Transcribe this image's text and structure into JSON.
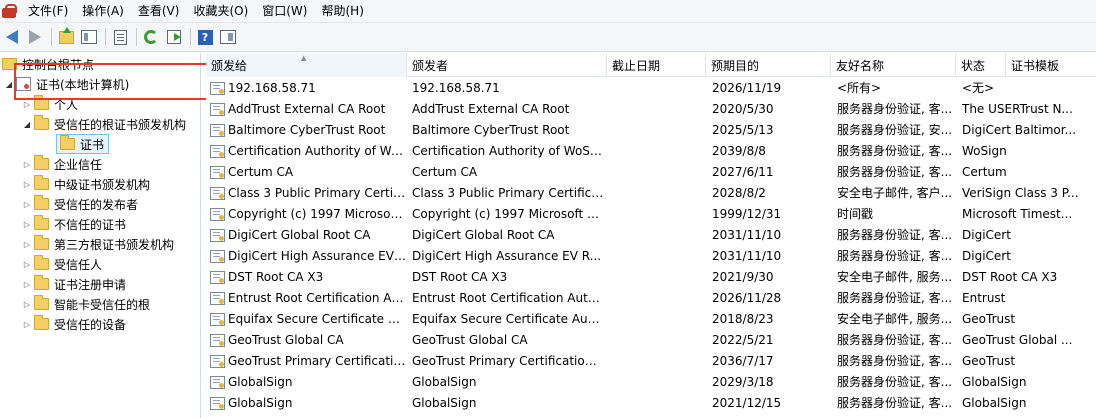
{
  "menubar": {
    "items": [
      "文件(F)",
      "操作(A)",
      "查看(V)",
      "收藏夹(O)",
      "窗口(W)",
      "帮助(H)"
    ]
  },
  "toolbar": {
    "icons": [
      "back-arrow-icon",
      "forward-arrow-icon",
      "up-folder-icon",
      "show-tree-icon",
      "properties-icon",
      "refresh-icon",
      "export-list-icon",
      "help-icon",
      "show-action-pane-icon"
    ]
  },
  "tree": {
    "root": "控制台根节点",
    "computer": "证书(本地计算机)",
    "personal": "个人",
    "trusted_root": "受信任的根证书颁发机构",
    "certs": "证书",
    "items": [
      "企业信任",
      "中级证书颁发机构",
      "受信任的发布者",
      "不信任的证书",
      "第三方根证书颁发机构",
      "受信任人",
      "证书注册申请",
      "智能卡受信任的根",
      "受信任的设备"
    ]
  },
  "list": {
    "columns": [
      "颁发给",
      "颁发者",
      "截止日期",
      "预期目的",
      "友好名称",
      "状态",
      "证书模板"
    ],
    "rows": [
      [
        "192.168.58.71",
        "192.168.58.71",
        "2026/11/19",
        "<所有>",
        "<无>"
      ],
      [
        "AddTrust External CA Root",
        "AddTrust External CA Root",
        "2020/5/30",
        "服务器身份验证, 客...",
        "The USERTrust N..."
      ],
      [
        "Baltimore CyberTrust Root",
        "Baltimore CyberTrust Root",
        "2025/5/13",
        "服务器身份验证, 安...",
        "DigiCert Baltimor..."
      ],
      [
        "Certification Authority of Wo...",
        "Certification Authority of WoSi...",
        "2039/8/8",
        "服务器身份验证, 客...",
        "WoSign"
      ],
      [
        "Certum CA",
        "Certum CA",
        "2027/6/11",
        "服务器身份验证, 客...",
        "Certum"
      ],
      [
        "Class 3 Public Primary Certifi...",
        "Class 3 Public Primary Certifica...",
        "2028/8/2",
        "安全电子邮件, 客户...",
        "VeriSign Class 3 P..."
      ],
      [
        "Copyright (c) 1997 Microsoft...",
        "Copyright (c) 1997 Microsoft C...",
        "1999/12/31",
        "时间戳",
        "Microsoft Timest..."
      ],
      [
        "DigiCert Global Root CA",
        "DigiCert Global Root CA",
        "2031/11/10",
        "服务器身份验证, 客...",
        "DigiCert"
      ],
      [
        "DigiCert High Assurance EV ...",
        "DigiCert High Assurance EV R...",
        "2031/11/10",
        "服务器身份验证, 客...",
        "DigiCert"
      ],
      [
        "DST Root CA X3",
        "DST Root CA X3",
        "2021/9/30",
        "安全电子邮件, 服务...",
        "DST Root CA X3"
      ],
      [
        "Entrust Root Certification Au...",
        "Entrust Root Certification Auth...",
        "2026/11/28",
        "服务器身份验证, 客...",
        "Entrust"
      ],
      [
        "Equifax Secure Certificate Au...",
        "Equifax Secure Certificate Auth...",
        "2018/8/23",
        "安全电子邮件, 服务...",
        "GeoTrust"
      ],
      [
        "GeoTrust Global CA",
        "GeoTrust Global CA",
        "2022/5/21",
        "服务器身份验证, 客...",
        "GeoTrust Global ..."
      ],
      [
        "GeoTrust Primary Certificatio...",
        "GeoTrust Primary Certification ...",
        "2036/7/17",
        "服务器身份验证, 客...",
        "GeoTrust"
      ],
      [
        "GlobalSign",
        "GlobalSign",
        "2029/3/18",
        "服务器身份验证, 客...",
        "GlobalSign"
      ],
      [
        "GlobalSign",
        "GlobalSign",
        "2021/12/15",
        "服务器身份验证, 客...",
        "GlobalSign"
      ]
    ]
  },
  "colors": {
    "highlight_border": "#e53b2f",
    "folder": "#f4d064",
    "selection": "#e5f3fb"
  }
}
